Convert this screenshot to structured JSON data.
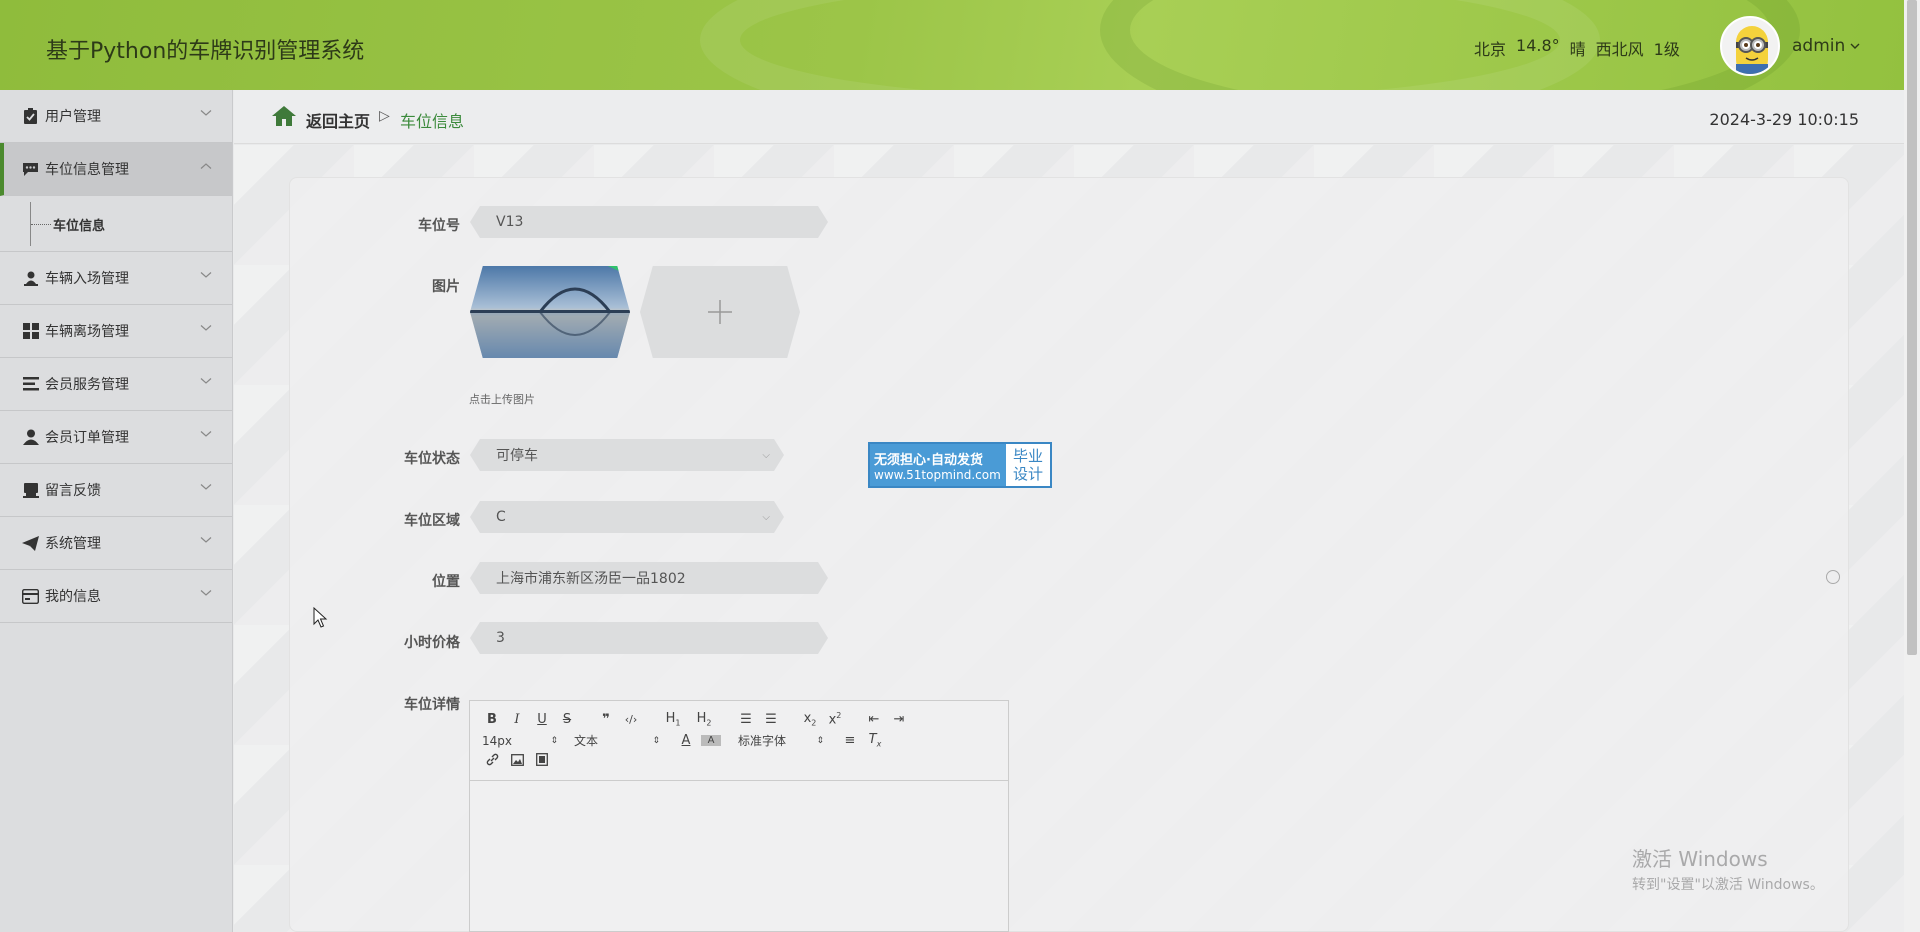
{
  "header": {
    "title": "基于Python的车牌识别管理系统",
    "weather": {
      "city": "北京",
      "temp": "14.8°",
      "condition": "晴",
      "wind": "西北风",
      "level": "1级"
    },
    "user": "admin"
  },
  "sidebar": {
    "items": [
      {
        "label": "用户管理",
        "icon": "clipboard-check-icon"
      },
      {
        "label": "车位信息管理",
        "icon": "chat-bubble-icon",
        "expanded": true,
        "children": [
          {
            "label": "车位信息"
          }
        ]
      },
      {
        "label": "车辆入场管理",
        "icon": "person-desk-icon"
      },
      {
        "label": "车辆离场管理",
        "icon": "grid-icon"
      },
      {
        "label": "会员服务管理",
        "icon": "list-icon"
      },
      {
        "label": "会员订单管理",
        "icon": "user-icon"
      },
      {
        "label": "留言反馈",
        "icon": "inbox-icon"
      },
      {
        "label": "系统管理",
        "icon": "paper-plane-icon"
      },
      {
        "label": "我的信息",
        "icon": "card-icon"
      }
    ]
  },
  "breadcrumb": {
    "home": "返回主页",
    "separator": "▷",
    "current": "车位信息"
  },
  "datetime": "2024-3-29 10:0:15",
  "form": {
    "space_no": {
      "label": "车位号",
      "value": "V13"
    },
    "image": {
      "label": "图片",
      "hint": "点击上传图片"
    },
    "status": {
      "label": "车位状态",
      "value": "可停车"
    },
    "area": {
      "label": "车位区域",
      "value": "C"
    },
    "location": {
      "label": "位置",
      "value": "上海市浦东新区汤臣一品1802"
    },
    "price": {
      "label": "小时价格",
      "value": "3"
    },
    "detail": {
      "label": "车位详情"
    }
  },
  "editor": {
    "font_size": "14px",
    "paragraph": "文本",
    "font_family": "标准字体"
  },
  "ad": {
    "line1": "无须担心·自动发货",
    "line2": "www.51topmind.com",
    "right1": "毕业",
    "right2": "设计"
  },
  "windows": {
    "line1": "激活 Windows",
    "line2": "转到\"设置\"以激活 Windows。"
  },
  "colors": {
    "accent": "#4b8a2e",
    "header_green": "#9cc548",
    "link_green": "#3b8a3b"
  }
}
